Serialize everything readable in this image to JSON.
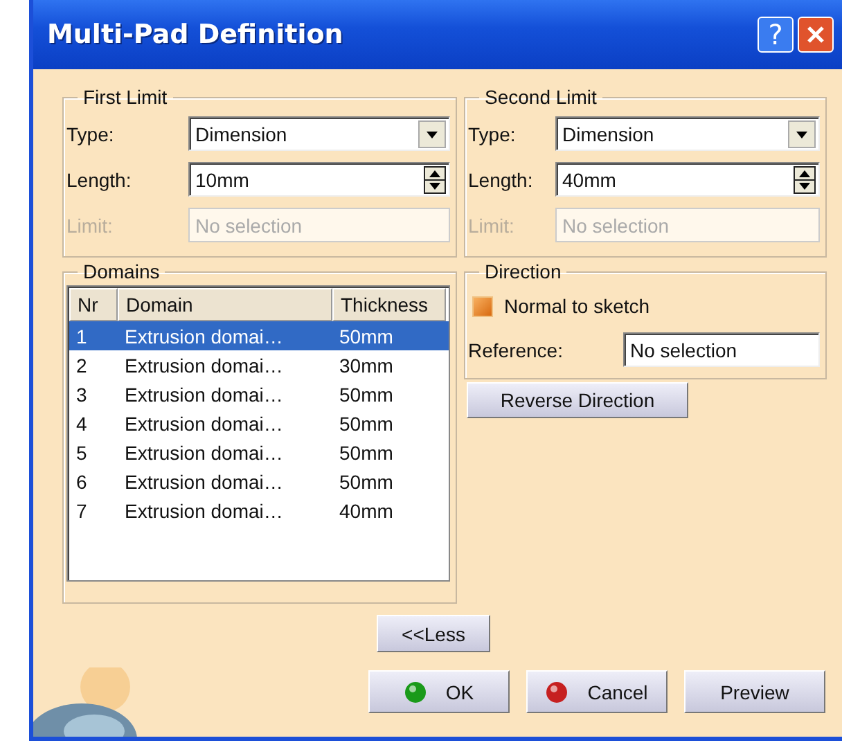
{
  "window": {
    "title": "Multi-Pad Definition",
    "help_label": "?"
  },
  "first_limit": {
    "title": "First Limit",
    "type_label": "Type:",
    "type_value": "Dimension",
    "length_label": "Length:",
    "length_value": "10mm",
    "limit_label": "Limit:",
    "limit_value": "No selection",
    "limit_disabled": true
  },
  "second_limit": {
    "title": "Second Limit",
    "type_label": "Type:",
    "type_value": "Dimension",
    "length_label": "Length:",
    "length_value": "40mm",
    "limit_label": "Limit:",
    "limit_value": "No selection",
    "limit_disabled": true
  },
  "domains": {
    "title": "Domains",
    "columns": [
      "Nr",
      "Domain",
      "Thickness"
    ],
    "rows": [
      {
        "nr": "1",
        "domain": "Extrusion domai…",
        "thickness": "50mm",
        "selected": true
      },
      {
        "nr": "2",
        "domain": "Extrusion domai…",
        "thickness": "30mm",
        "selected": false
      },
      {
        "nr": "3",
        "domain": "Extrusion domai…",
        "thickness": "50mm",
        "selected": false
      },
      {
        "nr": "4",
        "domain": "Extrusion domai…",
        "thickness": "50mm",
        "selected": false
      },
      {
        "nr": "5",
        "domain": "Extrusion domai…",
        "thickness": "50mm",
        "selected": false
      },
      {
        "nr": "6",
        "domain": "Extrusion domai…",
        "thickness": "50mm",
        "selected": false
      },
      {
        "nr": "7",
        "domain": "Extrusion domai…",
        "thickness": "40mm",
        "selected": false
      }
    ]
  },
  "direction": {
    "title": "Direction",
    "normal_to_sketch": {
      "label": "Normal to sketch",
      "checked": true
    },
    "reference_label": "Reference:",
    "reference_value": "No selection",
    "reverse_button": "Reverse Direction"
  },
  "less_button": "<<Less",
  "buttons": [
    {
      "label": "OK",
      "kind": "ok"
    },
    {
      "label": "Cancel",
      "kind": "cancel"
    },
    {
      "label": "Preview",
      "kind": "plain"
    }
  ]
}
